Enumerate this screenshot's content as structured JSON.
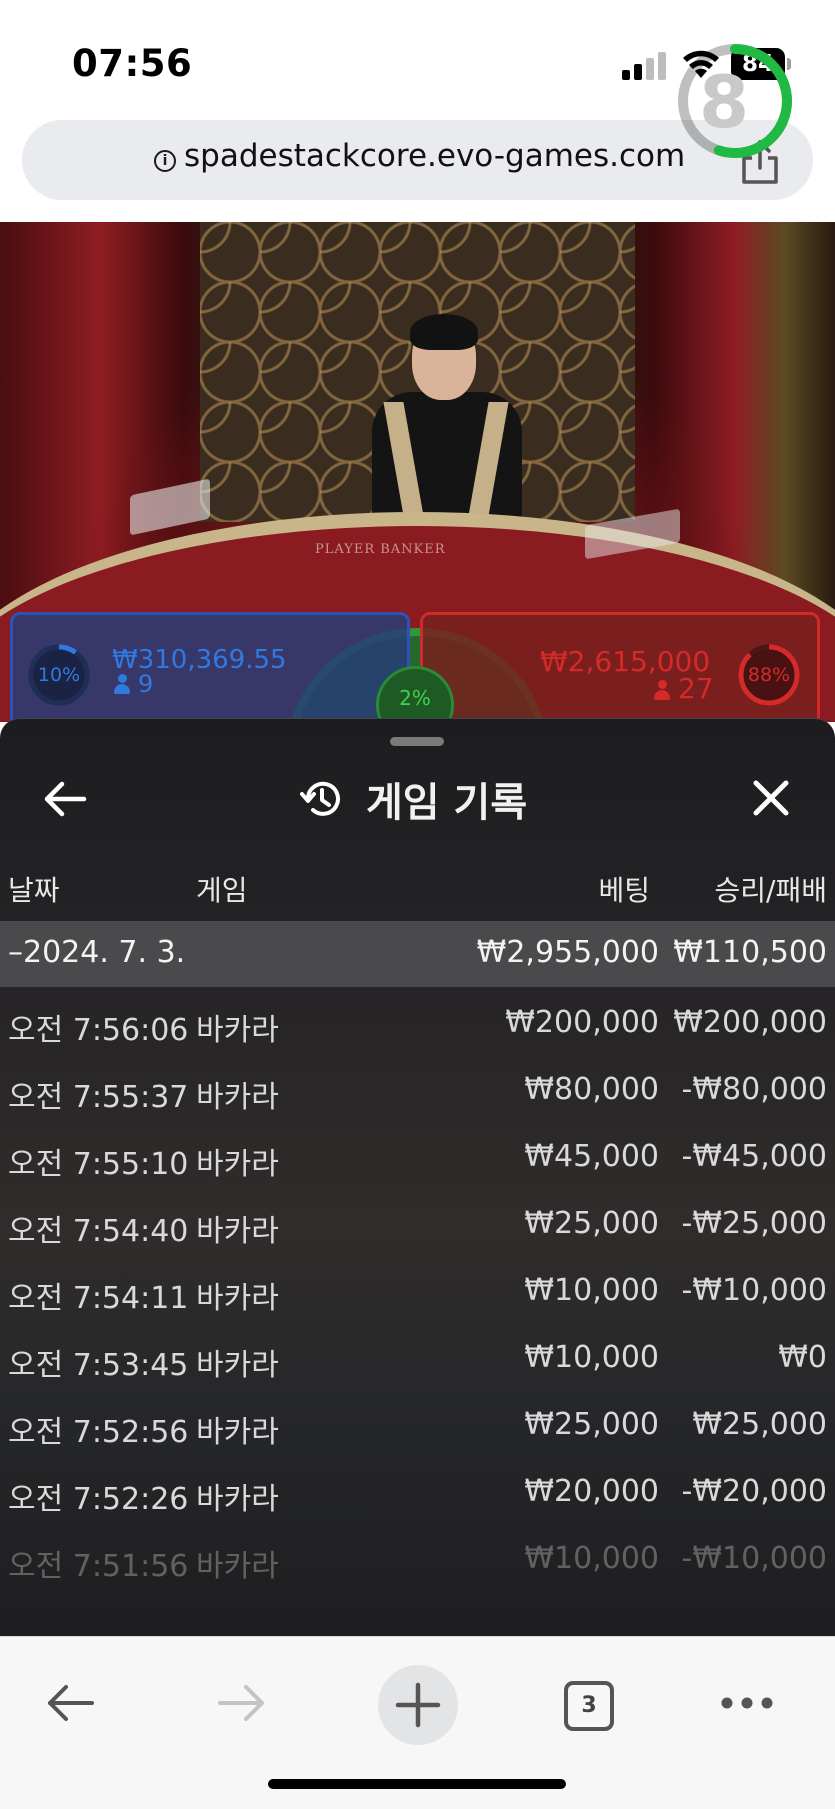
{
  "status_bar": {
    "time": "07:56",
    "battery": "84"
  },
  "browser": {
    "url": "spadestackcore.evo-games.com",
    "tab_count": "3",
    "icons": [
      "info-icon",
      "share-icon",
      "back-arrow-icon",
      "forward-arrow-icon",
      "plus-icon",
      "tabs-icon",
      "more-icon"
    ]
  },
  "game": {
    "timer": "8",
    "timer_progress": 0.55,
    "table_label": "PLAYER      BANKER",
    "player": {
      "percent": "10%",
      "percent_value": 0.1,
      "amount": "₩310,369.55",
      "count": "9"
    },
    "tie": {
      "percent": "2%",
      "percent_value": 0.02
    },
    "banker": {
      "percent": "88%",
      "percent_value": 0.88,
      "amount": "₩2,615,000",
      "count": "27"
    },
    "colors": {
      "player": "#2f79e0",
      "banker": "#d42a2a",
      "tie": "#3fd055",
      "timer": "#1fb944"
    }
  },
  "history": {
    "title": "게임 기록",
    "columns": {
      "date": "날짜",
      "game": "게임",
      "bet": "베팅",
      "win_loss": "승리/패배"
    },
    "summary": {
      "date": "–2024. 7. 3.",
      "bet": "₩2,955,000",
      "win_loss": "₩110,500"
    },
    "rows": [
      {
        "time": "오전 7:56:06",
        "game": "바카라",
        "bet": "₩200,000",
        "win_loss": "₩200,000"
      },
      {
        "time": "오전 7:55:37",
        "game": "바카라",
        "bet": "₩80,000",
        "win_loss": "-₩80,000"
      },
      {
        "time": "오전 7:55:10",
        "game": "바카라",
        "bet": "₩45,000",
        "win_loss": "-₩45,000"
      },
      {
        "time": "오전 7:54:40",
        "game": "바카라",
        "bet": "₩25,000",
        "win_loss": "-₩25,000"
      },
      {
        "time": "오전 7:54:11",
        "game": "바카라",
        "bet": "₩10,000",
        "win_loss": "-₩10,000"
      },
      {
        "time": "오전 7:53:45",
        "game": "바카라",
        "bet": "₩10,000",
        "win_loss": "₩0"
      },
      {
        "time": "오전 7:52:56",
        "game": "바카라",
        "bet": "₩25,000",
        "win_loss": "₩25,000"
      },
      {
        "time": "오전 7:52:26",
        "game": "바카라",
        "bet": "₩20,000",
        "win_loss": "-₩20,000"
      },
      {
        "time": "오전 7:51:56",
        "game": "바카라",
        "bet": "₩10,000",
        "win_loss": "-₩10,000"
      }
    ]
  }
}
